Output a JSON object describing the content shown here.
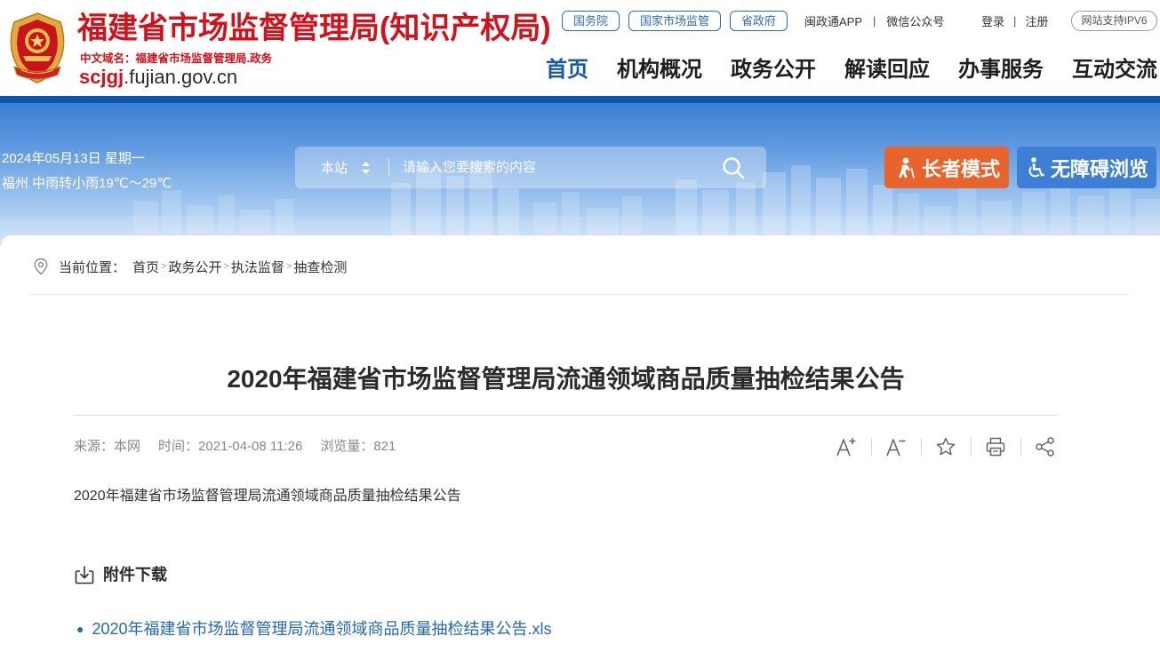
{
  "header": {
    "logo_icon": "emblem-icon",
    "site_title": "福建省市场监督管理局(知识产权局)",
    "cn_domain": "中文域名：福建省市场监督管理局.政务",
    "domain_prefix": "scjgj",
    "domain_suffix": ".fujian.gov.cn",
    "gov_links": [
      "国务院",
      "国家市场监管",
      "省政府"
    ],
    "app_link": "闽政通APP",
    "wechat_link": "微信公众号",
    "login": "登录",
    "register": "注册",
    "separator": "|",
    "ipv6_badge": "网站支持IPV6"
  },
  "nav": {
    "active_index": 0,
    "items": [
      "首页",
      "机构概况",
      "政务公开",
      "解读回应",
      "办事服务",
      "互动交流"
    ]
  },
  "banner": {
    "date": "2024年05月13日 星期一",
    "weather": "福州 中雨转小雨19℃～29℃",
    "search_scope": "本站",
    "search_placeholder": "请输入您要搜索的内容",
    "search_icon": "search-icon",
    "elder_icon": "elder-icon",
    "elder_mode": "长者模式",
    "accessible_icon": "wheelchair-icon",
    "accessible": "无障碍浏览"
  },
  "breadcrumb": {
    "icon": "location-pin-icon",
    "label": "当前位置：",
    "separator": ">",
    "items": [
      "首页",
      "政务公开",
      "执法监督",
      "抽查检测"
    ]
  },
  "article": {
    "title": "2020年福建省市场监督管理局流通领域商品质量抽检结果公告",
    "source": "来源：本网",
    "time": "时间：2021-04-08 11:26",
    "views": "浏览量：821",
    "tools": [
      "font-increase-icon",
      "font-decrease-icon",
      "favorite-star-icon",
      "print-icon",
      "share-icon"
    ],
    "body": "2020年福建省市场监督管理局流通领域商品质量抽检结果公告",
    "attachments_icon": "download-icon",
    "attachments_heading": "附件下载",
    "attachments": [
      "2020年福建省市场监督管理局流通领域商品质量抽检结果公告.xls"
    ]
  },
  "colors": {
    "accent": "#d2121b",
    "nav_active": "#1556a8",
    "link": "#2468b6",
    "gov_pill": "#2c6cc4",
    "elder_button": "#e8642c",
    "accessible_button": "#3d7fd4",
    "header_strip": "#0f54ab"
  }
}
